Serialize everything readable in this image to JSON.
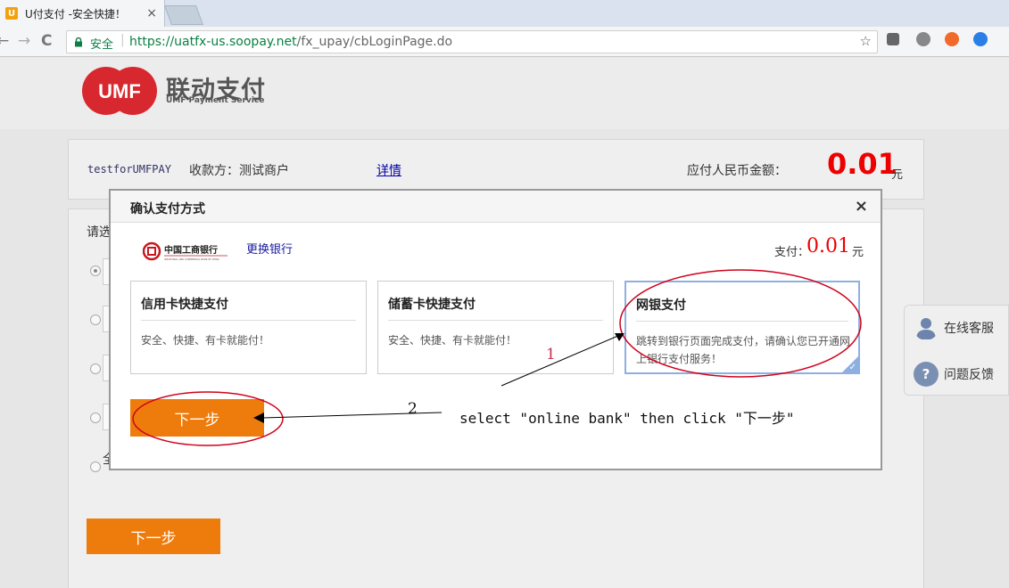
{
  "browser": {
    "tab_title": "U付支付 -安全快捷！",
    "tab_favicon": "U",
    "tab_close": "×",
    "secure_label": "安全",
    "url_host": "https://uatfx-us.soopay.net",
    "url_path": "/fx_upay/cbLoginPage.do",
    "back_icon": "←",
    "forward_icon": "→",
    "reload_icon": "C",
    "star_icon": "☆"
  },
  "header": {
    "logo_short": "UMF",
    "logo_cn": "联动支付",
    "logo_en": "UMF Payment Service"
  },
  "merchant": {
    "id": "testforUMFPAY",
    "payee": "收款方：测试商户",
    "detail_link": "详情",
    "amount_label": "应付人民币金额：",
    "amount_value": "0.01",
    "amount_unit": "元"
  },
  "main": {
    "select_label": "请选",
    "radio_stub_text": "全",
    "next_button": "下一步"
  },
  "modal": {
    "title": "确认支付方式",
    "close": "×",
    "bank_name": "中国工商银行",
    "bank_name_en": "INDUSTRIAL AND COMMERCIAL BANK OF CHINA",
    "change_bank": "更换银行",
    "pay_label": "支付：",
    "pay_value": "0.01",
    "pay_unit": "元",
    "options": [
      {
        "title": "信用卡快捷支付",
        "desc": "安全、快捷、有卡就能付！"
      },
      {
        "title": "储蓄卡快捷支付",
        "desc": "安全、快捷、有卡就能付！"
      },
      {
        "title": "网银支付",
        "desc": "跳转到银行页面完成支付，请确认您已开通网上银行支付服务！"
      }
    ],
    "selected_option": 2,
    "next_button": "下一步"
  },
  "side_panel": {
    "service": "在线客服",
    "feedback": "问题反馈",
    "feedback_icon_glyph": "?"
  },
  "annotations": {
    "instruction": "select \"online bank\" then click \"下一步\"",
    "label_1": "1",
    "label_2": "2"
  },
  "colors": {
    "accent_orange": "#ee7c0c",
    "amount_red": "#e00000",
    "brand_red": "#d8282f",
    "annotation_red": "#d0021b"
  }
}
